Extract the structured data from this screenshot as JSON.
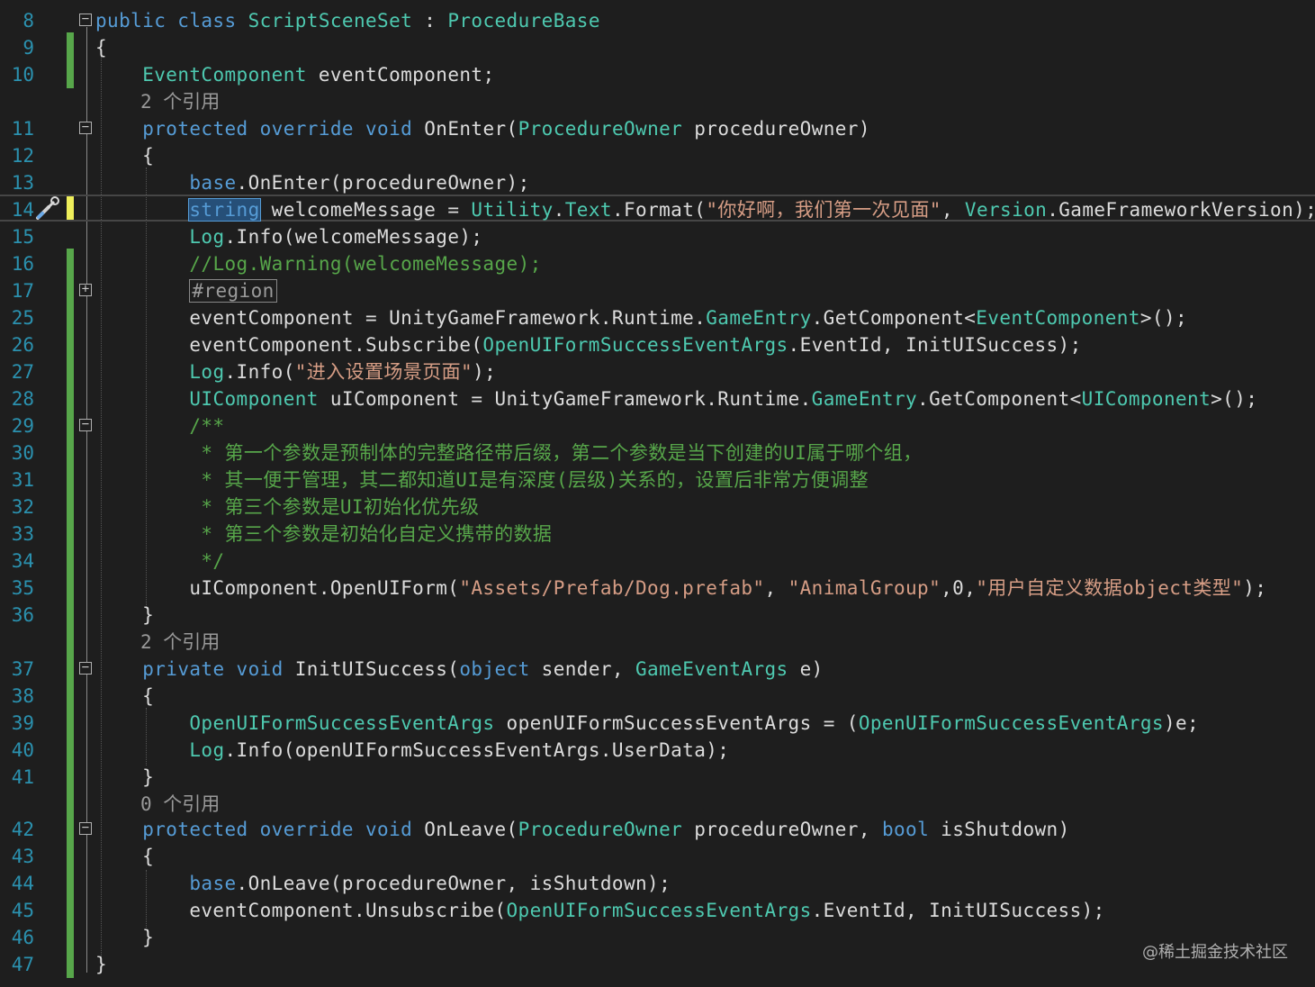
{
  "editor": {
    "colors": {
      "background": "#1e1e1e",
      "line_number": "#2b91af",
      "keyword": "#569cd6",
      "type": "#4ec9b0",
      "text": "#dcdcdc",
      "string": "#d69d85",
      "comment": "#57a64a",
      "change_saved": "#57a64a",
      "change_unsaved": "#efef5b"
    },
    "lines": [
      {
        "num": "8",
        "fold": "minus",
        "tokens": [
          {
            "t": "public class ",
            "c": "kw"
          },
          {
            "t": "ScriptSceneSet",
            "c": "ty"
          },
          {
            "t": " : ",
            "c": "tx"
          },
          {
            "t": "ProcedureBase",
            "c": "ty"
          }
        ]
      },
      {
        "num": "9",
        "tokens": [
          {
            "t": "{",
            "c": "tx"
          }
        ]
      },
      {
        "num": "10",
        "tokens": [
          {
            "t": "    ",
            "c": "tx"
          },
          {
            "t": "EventComponent",
            "c": "ty"
          },
          {
            "t": " eventComponent;",
            "c": "tx"
          }
        ]
      },
      {
        "ref": "2 个引用"
      },
      {
        "num": "11",
        "fold": "minus",
        "tokens": [
          {
            "t": "    ",
            "c": "tx"
          },
          {
            "t": "protected override void ",
            "c": "kw"
          },
          {
            "t": "OnEnter(",
            "c": "tx"
          },
          {
            "t": "ProcedureOwner",
            "c": "ty"
          },
          {
            "t": " procedureOwner)",
            "c": "tx"
          }
        ]
      },
      {
        "num": "12",
        "tokens": [
          {
            "t": "    {",
            "c": "tx"
          }
        ]
      },
      {
        "num": "13",
        "tokens": [
          {
            "t": "        ",
            "c": "tx"
          },
          {
            "t": "base",
            "c": "kw"
          },
          {
            "t": ".OnEnter(procedureOwner);",
            "c": "tx"
          }
        ]
      },
      {
        "num": "14",
        "current": true,
        "tokens": [
          {
            "t": "        ",
            "c": "tx"
          },
          {
            "t": "string",
            "c": "kw sel"
          },
          {
            "t": " welcomeMessage = ",
            "c": "tx"
          },
          {
            "t": "Utility",
            "c": "ty"
          },
          {
            "t": ".",
            "c": "tx"
          },
          {
            "t": "Text",
            "c": "ty"
          },
          {
            "t": ".Format(",
            "c": "tx"
          },
          {
            "t": "\"你好啊，我们第一次见面\"",
            "c": "st"
          },
          {
            "t": ", ",
            "c": "tx"
          },
          {
            "t": "Version",
            "c": "ty"
          },
          {
            "t": ".GameFrameworkVersion);",
            "c": "tx"
          }
        ]
      },
      {
        "num": "15",
        "tokens": [
          {
            "t": "        ",
            "c": "tx"
          },
          {
            "t": "Log",
            "c": "ty"
          },
          {
            "t": ".Info(welcomeMessage);",
            "c": "tx"
          }
        ]
      },
      {
        "num": "16",
        "tokens": [
          {
            "t": "        ",
            "c": "tx"
          },
          {
            "t": "//Log.Warning(welcomeMessage);",
            "c": "cm"
          }
        ]
      },
      {
        "num": "17",
        "fold": "plus",
        "tokens": [
          {
            "t": "        ",
            "c": "tx"
          },
          {
            "t": "#region",
            "c": "region-box"
          }
        ]
      },
      {
        "num": "25",
        "tokens": [
          {
            "t": "        eventComponent = UnityGameFramework.Runtime.",
            "c": "tx"
          },
          {
            "t": "GameEntry",
            "c": "ty"
          },
          {
            "t": ".GetComponent<",
            "c": "tx"
          },
          {
            "t": "EventComponent",
            "c": "ty"
          },
          {
            "t": ">();",
            "c": "tx"
          }
        ]
      },
      {
        "num": "26",
        "tokens": [
          {
            "t": "        eventComponent.Subscribe(",
            "c": "tx"
          },
          {
            "t": "OpenUIFormSuccessEventArgs",
            "c": "ty"
          },
          {
            "t": ".EventId, InitUISuccess);",
            "c": "tx"
          }
        ]
      },
      {
        "num": "27",
        "tokens": [
          {
            "t": "        ",
            "c": "tx"
          },
          {
            "t": "Log",
            "c": "ty"
          },
          {
            "t": ".Info(",
            "c": "tx"
          },
          {
            "t": "\"进入设置场景页面\"",
            "c": "st"
          },
          {
            "t": ");",
            "c": "tx"
          }
        ]
      },
      {
        "num": "28",
        "tokens": [
          {
            "t": "        ",
            "c": "tx"
          },
          {
            "t": "UIComponent",
            "c": "ty"
          },
          {
            "t": " uIComponent = UnityGameFramework.Runtime.",
            "c": "tx"
          },
          {
            "t": "GameEntry",
            "c": "ty"
          },
          {
            "t": ".GetComponent<",
            "c": "tx"
          },
          {
            "t": "UIComponent",
            "c": "ty"
          },
          {
            "t": ">();",
            "c": "tx"
          }
        ]
      },
      {
        "num": "29",
        "fold": "minus",
        "tokens": [
          {
            "t": "        /**",
            "c": "cm"
          }
        ]
      },
      {
        "num": "30",
        "tokens": [
          {
            "t": "         * 第一个参数是预制体的完整路径带后缀，第二个参数是当下创建的UI属于哪个组，",
            "c": "cm"
          }
        ]
      },
      {
        "num": "31",
        "tokens": [
          {
            "t": "         * 其一便于管理，其二都知道UI是有深度(层级)关系的，设置后非常方便调整",
            "c": "cm"
          }
        ]
      },
      {
        "num": "32",
        "tokens": [
          {
            "t": "         * 第三个参数是UI初始化优先级",
            "c": "cm"
          }
        ]
      },
      {
        "num": "33",
        "tokens": [
          {
            "t": "         * 第三个参数是初始化自定义携带的数据",
            "c": "cm"
          }
        ]
      },
      {
        "num": "34",
        "tokens": [
          {
            "t": "         */",
            "c": "cm"
          }
        ]
      },
      {
        "num": "35",
        "tokens": [
          {
            "t": "        uIComponent.OpenUIForm(",
            "c": "tx"
          },
          {
            "t": "\"Assets/Prefab/Dog.prefab\"",
            "c": "st"
          },
          {
            "t": ", ",
            "c": "tx"
          },
          {
            "t": "\"AnimalGroup\"",
            "c": "st"
          },
          {
            "t": ",0,",
            "c": "tx"
          },
          {
            "t": "\"用户自定义数据object类型\"",
            "c": "st"
          },
          {
            "t": ");",
            "c": "tx"
          }
        ]
      },
      {
        "num": "36",
        "tokens": [
          {
            "t": "    }",
            "c": "tx"
          }
        ]
      },
      {
        "ref": "2 个引用"
      },
      {
        "num": "37",
        "fold": "minus",
        "tokens": [
          {
            "t": "    ",
            "c": "tx"
          },
          {
            "t": "private void ",
            "c": "kw"
          },
          {
            "t": "InitUISuccess(",
            "c": "tx"
          },
          {
            "t": "object",
            "c": "kw"
          },
          {
            "t": " sender, ",
            "c": "tx"
          },
          {
            "t": "GameEventArgs",
            "c": "ty"
          },
          {
            "t": " e)",
            "c": "tx"
          }
        ]
      },
      {
        "num": "38",
        "tokens": [
          {
            "t": "    {",
            "c": "tx"
          }
        ]
      },
      {
        "num": "39",
        "tokens": [
          {
            "t": "        ",
            "c": "tx"
          },
          {
            "t": "OpenUIFormSuccessEventArgs",
            "c": "ty"
          },
          {
            "t": " openUIFormSuccessEventArgs = (",
            "c": "tx"
          },
          {
            "t": "OpenUIFormSuccessEventArgs",
            "c": "ty"
          },
          {
            "t": ")e;",
            "c": "tx"
          }
        ]
      },
      {
        "num": "40",
        "tokens": [
          {
            "t": "        ",
            "c": "tx"
          },
          {
            "t": "Log",
            "c": "ty"
          },
          {
            "t": ".Info(openUIFormSuccessEventArgs.UserData);",
            "c": "tx"
          }
        ]
      },
      {
        "num": "41",
        "tokens": [
          {
            "t": "    }",
            "c": "tx"
          }
        ]
      },
      {
        "ref": "0 个引用"
      },
      {
        "num": "42",
        "fold": "minus",
        "tokens": [
          {
            "t": "    ",
            "c": "tx"
          },
          {
            "t": "protected override void ",
            "c": "kw"
          },
          {
            "t": "OnLeave(",
            "c": "tx"
          },
          {
            "t": "ProcedureOwner",
            "c": "ty"
          },
          {
            "t": " procedureOwner, ",
            "c": "tx"
          },
          {
            "t": "bool",
            "c": "kw"
          },
          {
            "t": " isShutdown)",
            "c": "tx"
          }
        ]
      },
      {
        "num": "43",
        "tokens": [
          {
            "t": "    {",
            "c": "tx"
          }
        ]
      },
      {
        "num": "44",
        "tokens": [
          {
            "t": "        ",
            "c": "tx"
          },
          {
            "t": "base",
            "c": "kw"
          },
          {
            "t": ".OnLeave(procedureOwner, isShutdown);",
            "c": "tx"
          }
        ]
      },
      {
        "num": "45",
        "tokens": [
          {
            "t": "        eventComponent.Unsubscribe(",
            "c": "tx"
          },
          {
            "t": "OpenUIFormSuccessEventArgs",
            "c": "ty"
          },
          {
            "t": ".EventId, InitUISuccess);",
            "c": "tx"
          }
        ]
      },
      {
        "num": "46",
        "tokens": [
          {
            "t": "    }",
            "c": "tx"
          }
        ]
      },
      {
        "num": "47",
        "tokens": [
          {
            "t": "}",
            "c": "tx"
          }
        ]
      }
    ]
  },
  "watermark": "@稀土掘金技术社区"
}
